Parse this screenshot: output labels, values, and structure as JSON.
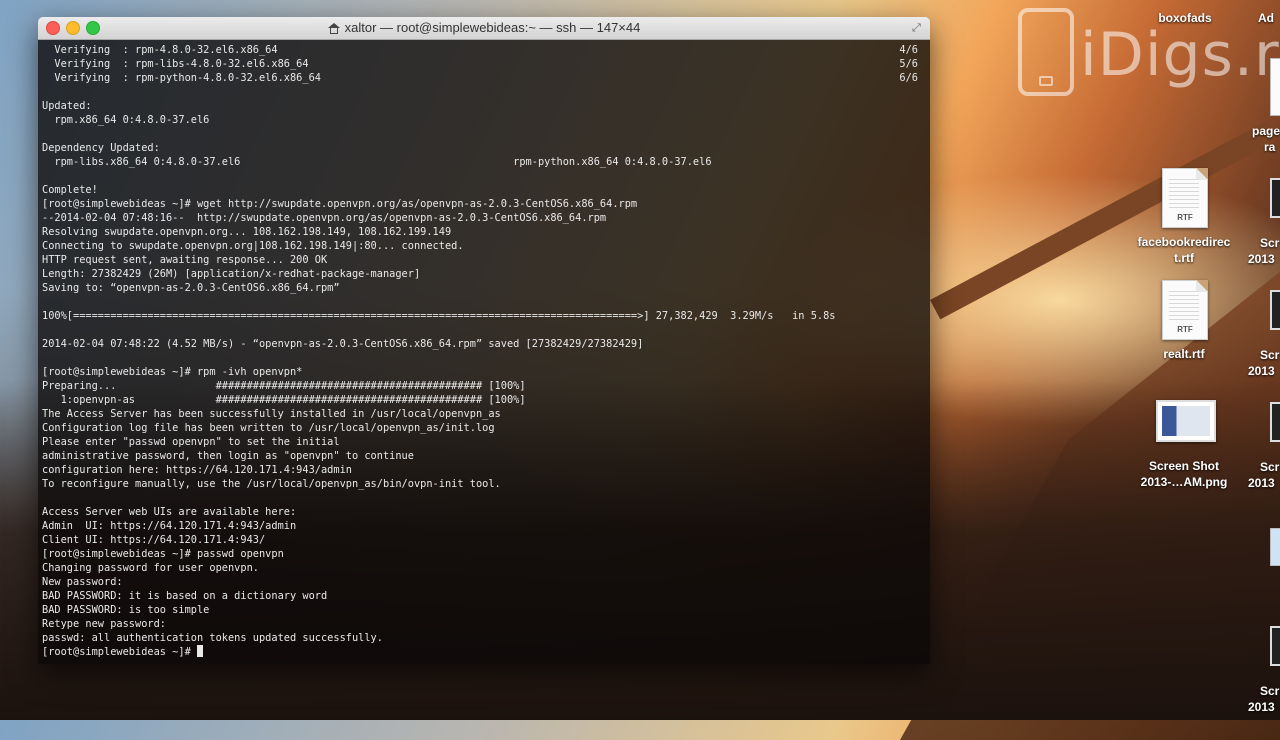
{
  "desktop": {
    "watermark": "iDigs.ru",
    "top_label_1": "boxofads",
    "top_label_2": "Ad",
    "edge_label_page_1": "page",
    "edge_label_page_2": "ra",
    "icons": [
      {
        "label_1": "facebookredirec",
        "label_2": "t.rtf",
        "type_tag": "RTF"
      },
      {
        "label_1": "realt.rtf",
        "type_tag": "RTF"
      },
      {
        "label_1": "Screen Shot",
        "label_2": "2013-…AM.png"
      }
    ],
    "edge_labels": [
      {
        "l1": "Scr",
        "l2": "2013"
      },
      {
        "l1": "Scr",
        "l2": "2013"
      },
      {
        "l1": "Scr",
        "l2": "2013"
      },
      {
        "l1": "Scr",
        "l2": "2013"
      }
    ]
  },
  "window": {
    "title": "xaltor — root@simplewebideas:~ — ssh — 147×44",
    "resize_glyph": "⤢"
  },
  "terminal": {
    "lines": [
      {
        "text": "  Verifying  : rpm-4.8.0-32.el6.x86_64",
        "right": "4/6"
      },
      {
        "text": "  Verifying  : rpm-libs-4.8.0-32.el6.x86_64",
        "right": "5/6"
      },
      {
        "text": "  Verifying  : rpm-python-4.8.0-32.el6.x86_64",
        "right": "6/6"
      },
      {
        "text": ""
      },
      {
        "text": "Updated:"
      },
      {
        "text": "  rpm.x86_64 0:4.8.0-37.el6"
      },
      {
        "text": ""
      },
      {
        "text": "Dependency Updated:"
      },
      {
        "text": "  rpm-libs.x86_64 0:4.8.0-37.el6                                            rpm-python.x86_64 0:4.8.0-37.el6"
      },
      {
        "text": ""
      },
      {
        "text": "Complete!"
      },
      {
        "text": "[root@simplewebideas ~]# wget http://swupdate.openvpn.org/as/openvpn-as-2.0.3-CentOS6.x86_64.rpm"
      },
      {
        "text": "--2014-02-04 07:48:16--  http://swupdate.openvpn.org/as/openvpn-as-2.0.3-CentOS6.x86_64.rpm"
      },
      {
        "text": "Resolving swupdate.openvpn.org... 108.162.198.149, 108.162.199.149"
      },
      {
        "text": "Connecting to swupdate.openvpn.org|108.162.198.149|:80... connected."
      },
      {
        "text": "HTTP request sent, awaiting response... 200 OK"
      },
      {
        "text": "Length: 27382429 (26M) [application/x-redhat-package-manager]"
      },
      {
        "text": "Saving to: “openvpn-as-2.0.3-CentOS6.x86_64.rpm”"
      },
      {
        "text": ""
      },
      {
        "text": "100%[===========================================================================================>] 27,382,429  3.29M/s   in 5.8s"
      },
      {
        "text": ""
      },
      {
        "text": "2014-02-04 07:48:22 (4.52 MB/s) - “openvpn-as-2.0.3-CentOS6.x86_64.rpm” saved [27382429/27382429]"
      },
      {
        "text": ""
      },
      {
        "text": "[root@simplewebideas ~]# rpm -ivh openvpn*"
      },
      {
        "text": "Preparing...                ########################################### [100%]"
      },
      {
        "text": "   1:openvpn-as             ########################################### [100%]"
      },
      {
        "text": "The Access Server has been successfully installed in /usr/local/openvpn_as"
      },
      {
        "text": "Configuration log file has been written to /usr/local/openvpn_as/init.log"
      },
      {
        "text": "Please enter \"passwd openvpn\" to set the initial"
      },
      {
        "text": "administrative password, then login as \"openvpn\" to continue"
      },
      {
        "text": "configuration here: https://64.120.171.4:943/admin"
      },
      {
        "text": "To reconfigure manually, use the /usr/local/openvpn_as/bin/ovpn-init tool."
      },
      {
        "text": ""
      },
      {
        "text": "Access Server web UIs are available here:"
      },
      {
        "text": "Admin  UI: https://64.120.171.4:943/admin"
      },
      {
        "text": "Client UI: https://64.120.171.4:943/"
      },
      {
        "text": "[root@simplewebideas ~]# passwd openvpn"
      },
      {
        "text": "Changing password for user openvpn."
      },
      {
        "text": "New password:"
      },
      {
        "text": "BAD PASSWORD: it is based on a dictionary word"
      },
      {
        "text": "BAD PASSWORD: is too simple"
      },
      {
        "text": "Retype new password:"
      },
      {
        "text": "passwd: all authentication tokens updated successfully."
      }
    ],
    "prompt": "[root@simplewebideas ~]# "
  }
}
